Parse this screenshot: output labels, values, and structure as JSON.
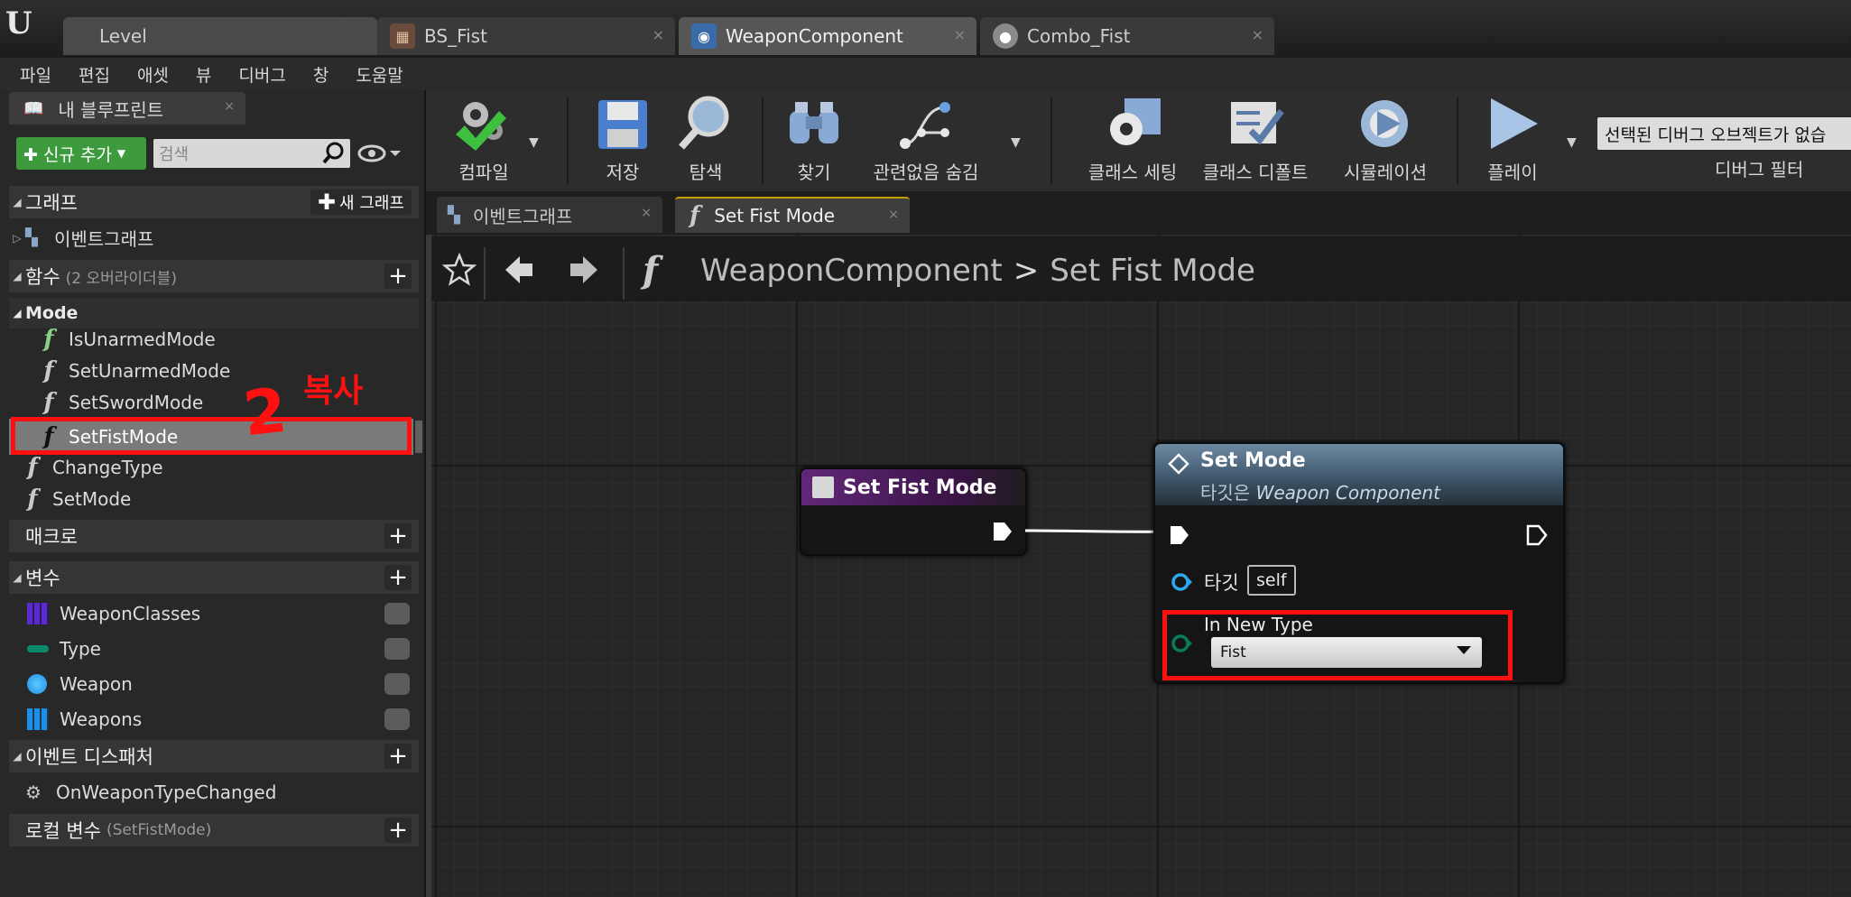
{
  "doc_tabs": [
    {
      "label": "Level"
    },
    {
      "label": "BS_Fist"
    },
    {
      "label": "WeaponComponent"
    },
    {
      "label": "Combo_Fist"
    }
  ],
  "menu": [
    "파일",
    "편집",
    "애셋",
    "뷰",
    "디버그",
    "창",
    "도움말"
  ],
  "my_blueprint": {
    "tab_label": "내 블루프린트",
    "add_new_label": "✚ 신규 추가",
    "search_placeholder": "검색",
    "graphs": {
      "header": "그래프",
      "new_button": "새 그래프",
      "items": [
        "이벤트그래프"
      ]
    },
    "functions": {
      "header": "함수",
      "override_note": "(2 오버라이더블)",
      "category": "Mode",
      "category_items": [
        "IsUnarmedMode",
        "SetUnarmedMode",
        "SetSwordMode",
        "SetFistMode"
      ],
      "items": [
        "ChangeType",
        "SetMode"
      ]
    },
    "macros": {
      "header": "매크로"
    },
    "variables": {
      "header": "변수",
      "items": [
        {
          "name": "WeaponClasses",
          "color": "#5a2ccf"
        },
        {
          "name": "Type",
          "color": "#0a8a6a"
        },
        {
          "name": "Weapon",
          "color": "#1f8fe6"
        },
        {
          "name": "Weapons",
          "color": "#1f8fe6"
        }
      ]
    },
    "dispatchers": {
      "header": "이벤트 디스패처",
      "items": [
        "OnWeaponTypeChanged"
      ]
    },
    "local_vars": {
      "header": "로컬 변수",
      "note": "(SetFistMode)"
    }
  },
  "annotation": {
    "number": "2",
    "text": "복사"
  },
  "toolbar": {
    "compile": "컴파일",
    "save": "저장",
    "browse": "탐색",
    "find": "찾기",
    "hide_unrelated": "관련없음 숨김",
    "class_settings": "클래스 세팅",
    "class_defaults": "클래스 디폴트",
    "simulation": "시뮬레이션",
    "play": "플레이",
    "debug_select": "선택된 디버그 오브젝트가 없습",
    "debug_filter": "디버그 필터"
  },
  "graph_tabs": [
    "이벤트그래프",
    "Set Fist Mode"
  ],
  "breadcrumb": {
    "root": "WeaponComponent",
    "current": "Set Fist Mode"
  },
  "nodes": {
    "entry": {
      "title": "Set Fist Mode"
    },
    "set_mode": {
      "title": "Set Mode",
      "subtitle_prefix": "타깃은",
      "subtitle_target": "Weapon Component",
      "target_label": "타깃",
      "target_value": "self",
      "param_label": "In New Type",
      "param_value": "Fist"
    }
  }
}
